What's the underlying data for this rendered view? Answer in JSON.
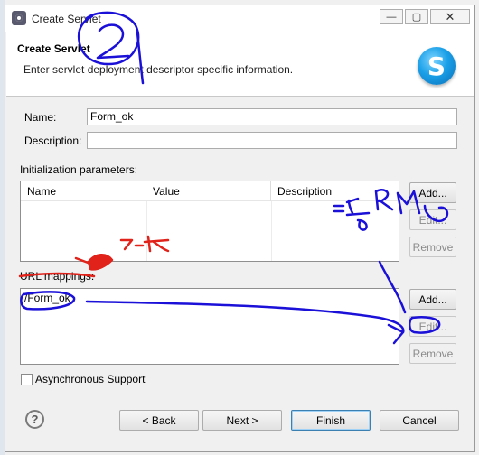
{
  "window": {
    "title": "Create Servlet",
    "minimize_label": "—",
    "maximize_label": "▢",
    "close_label": "✕"
  },
  "header": {
    "title": "Create Servlet",
    "description": "Enter servlet deployment descriptor specific information.",
    "logo_letter": "S"
  },
  "form": {
    "name_label": "Name:",
    "name_value": "Form_ok",
    "description_label": "Description:",
    "description_value": "",
    "init_params_label": "Initialization parameters:",
    "init_params_columns": [
      "Name",
      "Value",
      "Description"
    ],
    "url_mappings_label": "URL mappings:",
    "url_mappings": [
      "/Form_ok"
    ],
    "async_label": "Asynchronous Support",
    "async_checked": false
  },
  "init_buttons": {
    "add": "Add...",
    "edit": "Edit...",
    "remove": "Remove"
  },
  "url_buttons": {
    "add": "Add...",
    "edit": "Edit...",
    "remove": "Remove"
  },
  "footer": {
    "help_label": "?",
    "back": "< Back",
    "next": "Next >",
    "finish": "Finish",
    "cancel": "Cancel"
  },
  "annotations": {
    "handwritten_number": "2",
    "handwritten_note": "7-12",
    "ink_color": "#1a10d8",
    "marker_color": "#e0221a"
  }
}
